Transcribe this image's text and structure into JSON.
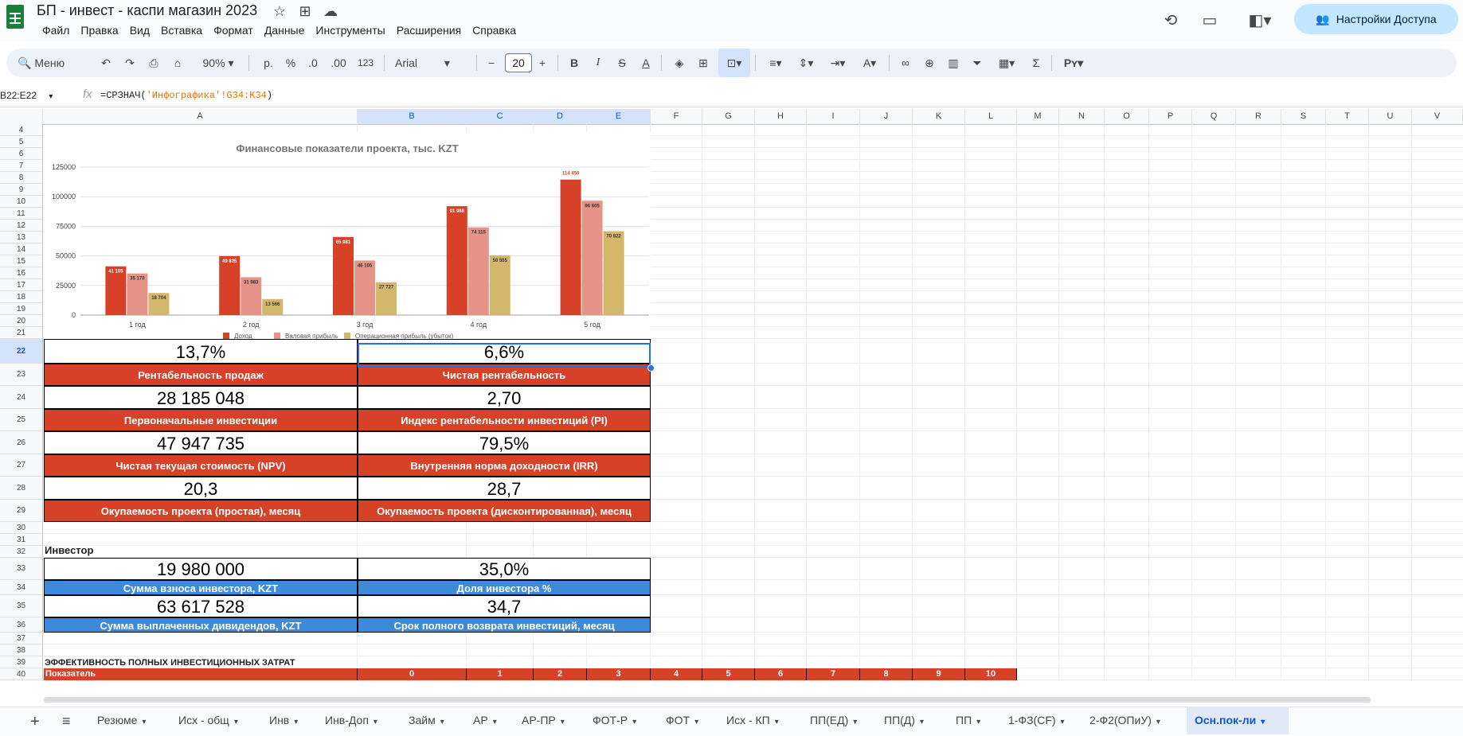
{
  "app": {
    "doc_title": "БП - инвест - каспи магазин 2023",
    "menu": [
      "Файл",
      "Правка",
      "Вид",
      "Вставка",
      "Формат",
      "Данные",
      "Инструменты",
      "Расширения",
      "Справка"
    ],
    "share_label": "Настройки Доступа"
  },
  "toolbar": {
    "search_label": "Меню",
    "zoom": "90%",
    "currency": "р.",
    "percent": "%",
    "dec_less": ".0",
    "dec_more": ".00",
    "format_123": "123",
    "font": "Arial",
    "font_size": "20"
  },
  "formula_bar": {
    "name_box": "B22:E22",
    "fx": "fx",
    "formula_prefix": "=СРЗНАЧ(",
    "formula_string": "'Инфографика'",
    "formula_ref": "!G34:K34",
    "formula_suffix": ")"
  },
  "columns": [
    {
      "label": "A",
      "selected": false
    },
    {
      "label": "B",
      "selected": true
    },
    {
      "label": "C",
      "selected": true
    },
    {
      "label": "D",
      "selected": true
    },
    {
      "label": "E",
      "selected": true
    },
    {
      "label": "F",
      "selected": false
    },
    {
      "label": "G",
      "selected": false
    },
    {
      "label": "H",
      "selected": false
    },
    {
      "label": "I",
      "selected": false
    },
    {
      "label": "J",
      "selected": false
    },
    {
      "label": "K",
      "selected": false
    },
    {
      "label": "L",
      "selected": false
    },
    {
      "label": "M",
      "selected": false
    },
    {
      "label": "N",
      "selected": false
    },
    {
      "label": "O",
      "selected": false
    },
    {
      "label": "P",
      "selected": false
    },
    {
      "label": "Q",
      "selected": false
    },
    {
      "label": "R",
      "selected": false
    },
    {
      "label": "S",
      "selected": false
    },
    {
      "label": "T",
      "selected": false
    },
    {
      "label": "U",
      "selected": false
    },
    {
      "label": "V",
      "selected": false
    }
  ],
  "rows": [
    "4",
    "5",
    "6",
    "7",
    "8",
    "9",
    "10",
    "11",
    "12",
    "13",
    "14",
    "15",
    "16",
    "17",
    "18",
    "19",
    "20",
    "21",
    "22",
    "23",
    "24",
    "25",
    "26",
    "27",
    "28",
    "29",
    "30",
    "31",
    "32",
    "33",
    "34",
    "35",
    "36",
    "37",
    "38",
    "39",
    "40"
  ],
  "chart_data": {
    "type": "bar",
    "title": "Финансовые показатели проекта, тыс. KZT",
    "categories": [
      "1 год",
      "2 год",
      "3 год",
      "4 год",
      "5 год"
    ],
    "ylim": [
      0,
      125000
    ],
    "yticks": [
      "125000",
      "100000",
      "75000",
      "50000",
      "25000",
      "0"
    ],
    "legend_position": "bottom",
    "series": [
      {
        "name": "Доход",
        "color": "#d64128",
        "values": [
          41185,
          49825,
          65981,
          91988,
          114450
        ],
        "labels": [
          "41 185",
          "49 825",
          "65 981",
          "91 988",
          "114 450"
        ]
      },
      {
        "name": "Валовая прибыль",
        "color": "#e59487",
        "values": [
          35170,
          31983,
          46105,
          74115,
          96605
        ],
        "labels": [
          "35 170",
          "31 983",
          "46 105",
          "74 115",
          "96 605"
        ]
      },
      {
        "name": "Операционная прибыль (убыток)",
        "color": "#d5b66d",
        "values": [
          18704,
          13566,
          27727,
          50555,
          70822
        ],
        "labels": [
          "18 704",
          "13 566",
          "27 727",
          "50 555",
          "70 822"
        ]
      }
    ]
  },
  "kpis": [
    {
      "left_value": "13,7%",
      "left_label": "Рентабельность продаж",
      "right_value": "6,6%",
      "right_label": "Чистая рентабельность"
    },
    {
      "left_value": "28 185 048",
      "left_label": "Первоначальные инвестиции",
      "right_value": "2,70",
      "right_label": "Индекс рентабельности инвестиций (PI)"
    },
    {
      "left_value": "47 947 735",
      "left_label": "Чистая текущая стоимость (NPV)",
      "right_value": "79,5%",
      "right_label": "Внутренняя норма доходности (IRR)"
    },
    {
      "left_value": "20,3",
      "left_label": "Окупаемость проекта (простая), месяц",
      "right_value": "28,7",
      "right_label": "Окупаемость проекта (дисконтированная), месяц"
    }
  ],
  "investor": {
    "heading": "Инвестор",
    "items": [
      {
        "left_value": "19 980 000",
        "left_label": "Сумма взноса инвестора, KZT",
        "right_value": "35,0%",
        "right_label": "Доля инвестора %"
      },
      {
        "left_value": "63 617 528",
        "left_label": "Сумма выплаченных дивидендов, KZT",
        "right_value": "34,7",
        "right_label": "Срок полного возврата инвестиций, месяц"
      }
    ]
  },
  "efficiency": {
    "heading": "ЭФФЕКТИВНОСТЬ ПОЛНЫХ ИНВЕСТИЦИОННЫХ ЗАТРАТ",
    "header_row": [
      "Показатель",
      "0",
      "1",
      "2",
      "3",
      "4",
      "5",
      "6",
      "7",
      "8",
      "9",
      "10"
    ]
  },
  "sheet_tabs": [
    {
      "label": "Резюме",
      "active": false
    },
    {
      "label": "Исх - общ",
      "active": false
    },
    {
      "label": "Инв",
      "active": false
    },
    {
      "label": "Инв-Доп",
      "active": false
    },
    {
      "label": "Займ",
      "active": false
    },
    {
      "label": "АР",
      "active": false
    },
    {
      "label": "АР-ПР",
      "active": false
    },
    {
      "label": "ФОТ-Р",
      "active": false
    },
    {
      "label": "ФОТ",
      "active": false
    },
    {
      "label": "Исх - КП",
      "active": false
    },
    {
      "label": "ПП(ЕД)",
      "active": false
    },
    {
      "label": "ПП(Д)",
      "active": false
    },
    {
      "label": "ПП",
      "active": false
    },
    {
      "label": "1-ФЗ(CF)",
      "active": false
    },
    {
      "label": "2-Ф2(ОПиУ)",
      "active": false
    },
    {
      "label": "Осн.пок-ли",
      "active": true
    }
  ]
}
